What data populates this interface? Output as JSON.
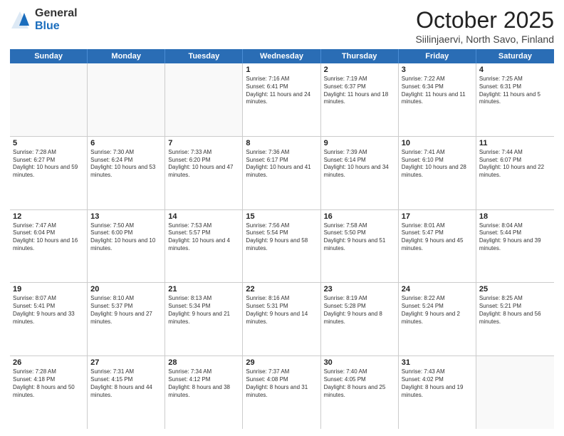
{
  "header": {
    "logo_general": "General",
    "logo_blue": "Blue",
    "month_title": "October 2025",
    "location": "Siilinjaervi, North Savo, Finland"
  },
  "days_of_week": [
    "Sunday",
    "Monday",
    "Tuesday",
    "Wednesday",
    "Thursday",
    "Friday",
    "Saturday"
  ],
  "weeks": [
    [
      {
        "day": "",
        "info": ""
      },
      {
        "day": "",
        "info": ""
      },
      {
        "day": "",
        "info": ""
      },
      {
        "day": "1",
        "info": "Sunrise: 7:16 AM\nSunset: 6:41 PM\nDaylight: 11 hours and 24 minutes."
      },
      {
        "day": "2",
        "info": "Sunrise: 7:19 AM\nSunset: 6:37 PM\nDaylight: 11 hours and 18 minutes."
      },
      {
        "day": "3",
        "info": "Sunrise: 7:22 AM\nSunset: 6:34 PM\nDaylight: 11 hours and 11 minutes."
      },
      {
        "day": "4",
        "info": "Sunrise: 7:25 AM\nSunset: 6:31 PM\nDaylight: 11 hours and 5 minutes."
      }
    ],
    [
      {
        "day": "5",
        "info": "Sunrise: 7:28 AM\nSunset: 6:27 PM\nDaylight: 10 hours and 59 minutes."
      },
      {
        "day": "6",
        "info": "Sunrise: 7:30 AM\nSunset: 6:24 PM\nDaylight: 10 hours and 53 minutes."
      },
      {
        "day": "7",
        "info": "Sunrise: 7:33 AM\nSunset: 6:20 PM\nDaylight: 10 hours and 47 minutes."
      },
      {
        "day": "8",
        "info": "Sunrise: 7:36 AM\nSunset: 6:17 PM\nDaylight: 10 hours and 41 minutes."
      },
      {
        "day": "9",
        "info": "Sunrise: 7:39 AM\nSunset: 6:14 PM\nDaylight: 10 hours and 34 minutes."
      },
      {
        "day": "10",
        "info": "Sunrise: 7:41 AM\nSunset: 6:10 PM\nDaylight: 10 hours and 28 minutes."
      },
      {
        "day": "11",
        "info": "Sunrise: 7:44 AM\nSunset: 6:07 PM\nDaylight: 10 hours and 22 minutes."
      }
    ],
    [
      {
        "day": "12",
        "info": "Sunrise: 7:47 AM\nSunset: 6:04 PM\nDaylight: 10 hours and 16 minutes."
      },
      {
        "day": "13",
        "info": "Sunrise: 7:50 AM\nSunset: 6:00 PM\nDaylight: 10 hours and 10 minutes."
      },
      {
        "day": "14",
        "info": "Sunrise: 7:53 AM\nSunset: 5:57 PM\nDaylight: 10 hours and 4 minutes."
      },
      {
        "day": "15",
        "info": "Sunrise: 7:56 AM\nSunset: 5:54 PM\nDaylight: 9 hours and 58 minutes."
      },
      {
        "day": "16",
        "info": "Sunrise: 7:58 AM\nSunset: 5:50 PM\nDaylight: 9 hours and 51 minutes."
      },
      {
        "day": "17",
        "info": "Sunrise: 8:01 AM\nSunset: 5:47 PM\nDaylight: 9 hours and 45 minutes."
      },
      {
        "day": "18",
        "info": "Sunrise: 8:04 AM\nSunset: 5:44 PM\nDaylight: 9 hours and 39 minutes."
      }
    ],
    [
      {
        "day": "19",
        "info": "Sunrise: 8:07 AM\nSunset: 5:41 PM\nDaylight: 9 hours and 33 minutes."
      },
      {
        "day": "20",
        "info": "Sunrise: 8:10 AM\nSunset: 5:37 PM\nDaylight: 9 hours and 27 minutes."
      },
      {
        "day": "21",
        "info": "Sunrise: 8:13 AM\nSunset: 5:34 PM\nDaylight: 9 hours and 21 minutes."
      },
      {
        "day": "22",
        "info": "Sunrise: 8:16 AM\nSunset: 5:31 PM\nDaylight: 9 hours and 14 minutes."
      },
      {
        "day": "23",
        "info": "Sunrise: 8:19 AM\nSunset: 5:28 PM\nDaylight: 9 hours and 8 minutes."
      },
      {
        "day": "24",
        "info": "Sunrise: 8:22 AM\nSunset: 5:24 PM\nDaylight: 9 hours and 2 minutes."
      },
      {
        "day": "25",
        "info": "Sunrise: 8:25 AM\nSunset: 5:21 PM\nDaylight: 8 hours and 56 minutes."
      }
    ],
    [
      {
        "day": "26",
        "info": "Sunrise: 7:28 AM\nSunset: 4:18 PM\nDaylight: 8 hours and 50 minutes."
      },
      {
        "day": "27",
        "info": "Sunrise: 7:31 AM\nSunset: 4:15 PM\nDaylight: 8 hours and 44 minutes."
      },
      {
        "day": "28",
        "info": "Sunrise: 7:34 AM\nSunset: 4:12 PM\nDaylight: 8 hours and 38 minutes."
      },
      {
        "day": "29",
        "info": "Sunrise: 7:37 AM\nSunset: 4:08 PM\nDaylight: 8 hours and 31 minutes."
      },
      {
        "day": "30",
        "info": "Sunrise: 7:40 AM\nSunset: 4:05 PM\nDaylight: 8 hours and 25 minutes."
      },
      {
        "day": "31",
        "info": "Sunrise: 7:43 AM\nSunset: 4:02 PM\nDaylight: 8 hours and 19 minutes."
      },
      {
        "day": "",
        "info": ""
      }
    ]
  ]
}
